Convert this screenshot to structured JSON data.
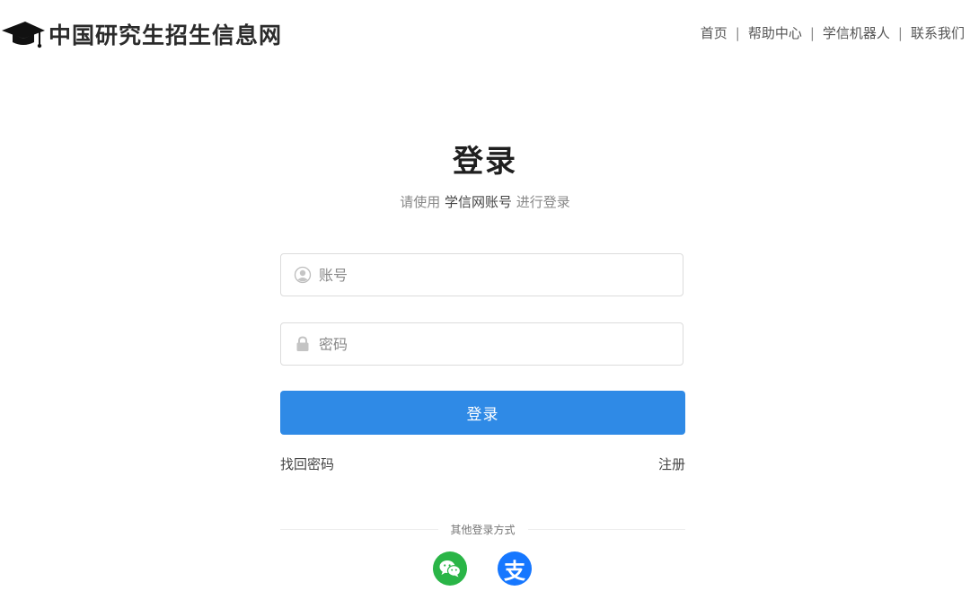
{
  "header": {
    "brand_title": "中国研究生招生信息网",
    "brand_icon": "graduation-cap-icon",
    "nav": [
      {
        "label": "首页"
      },
      {
        "label": "帮助中心"
      },
      {
        "label": "学信机器人"
      },
      {
        "label": "联系我们"
      }
    ],
    "nav_separator": "|"
  },
  "login": {
    "title": "登录",
    "subtitle_prefix": "请使用",
    "subtitle_emphasis": "学信网账号",
    "subtitle_suffix": "进行登录",
    "account_placeholder": "账号",
    "account_icon": "user-icon",
    "password_placeholder": "密码",
    "password_icon": "lock-icon",
    "submit_label": "登录",
    "submit_color": "#2f8ae6",
    "forgot_password": "找回密码",
    "register": "注册",
    "other_methods_label": "其他登录方式",
    "other_methods": [
      {
        "name": "wechat",
        "icon": "wechat-icon",
        "color": "#2ab547"
      },
      {
        "name": "alipay",
        "icon": "alipay-icon",
        "glyph": "支",
        "color": "#1677ff"
      }
    ]
  }
}
